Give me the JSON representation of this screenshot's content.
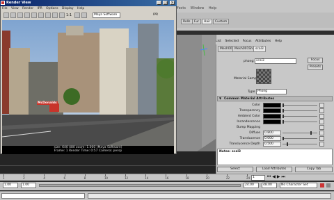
{
  "maya": {
    "menubar": [
      "Effects",
      "Window",
      "Help"
    ],
    "shelf_tabs": [
      "Rolls",
      "Fur",
      "Hair",
      "Custom"
    ],
    "active_shelf": "Hair"
  },
  "attribute_editor": {
    "menu": [
      "List",
      "Selected",
      "Focus",
      "Attributes",
      "Help"
    ],
    "tabs": [
      "Mesh001",
      "Mesh001Shape",
      "scal3"
    ],
    "active_tab": "scal3",
    "node_type_label": "phong:",
    "node_name": "scal3",
    "focus_button": "Focus",
    "presets_button": "Presets",
    "material_sample_label": "Material Sample",
    "type_label": "Type",
    "type_value": "Phong",
    "section_header": "Common Material Attributes",
    "rows": [
      {
        "label": "Color"
      },
      {
        "label": "Transparency"
      },
      {
        "label": "Ambient Color"
      },
      {
        "label": "Incandescence"
      },
      {
        "label": "Bump Mapping"
      },
      {
        "label": "Diffuse",
        "value": "0.800"
      },
      {
        "label": "Translucence",
        "value": "0.000"
      },
      {
        "label": "Translucence Depth",
        "value": "0.500"
      }
    ],
    "notes_label": "Notes:",
    "notes_value": "scal3",
    "select_button": "Select",
    "load_attributes_button": "Load Attributes",
    "copy_tab_button": "Copy Tab"
  },
  "render_view": {
    "title": "Render View",
    "menu": [
      "File",
      "View",
      "Render",
      "IPR",
      "Options",
      "Display",
      "Help"
    ],
    "zoom_label": "1:1",
    "ipr_label": "IPR",
    "renderer": "Maya Software",
    "sign_text": "McDonalds",
    "info_line1": "size: 640 480 zoom: 1.000 (Maya Software)",
    "info_line2": "Frame: 1  Render Time: 0:57  Camera: persp"
  },
  "timeline": {
    "start_frame": "1",
    "range_start": "1.00",
    "range_end": "24.00",
    "end_frame_field": "1.00",
    "playback_end": "48.00",
    "character_set": "No Character Set",
    "ticks": [
      "1",
      "2",
      "4",
      "6",
      "8",
      "10",
      "12",
      "14",
      "16",
      "18",
      "20",
      "22",
      "24"
    ]
  },
  "colors": {
    "title_bar": "#0a246a",
    "maya_grey": "#c6c6c6",
    "viewport": "#8c8c8c"
  }
}
